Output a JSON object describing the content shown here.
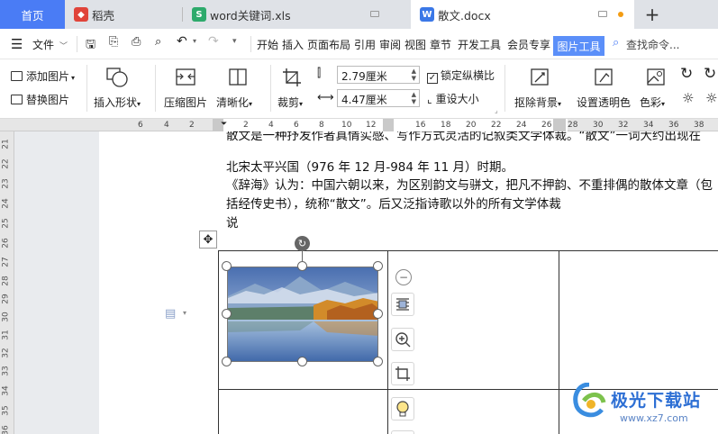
{
  "tabs": {
    "home": "首页",
    "daoke": "稻壳",
    "xls": "word关键词.xls",
    "doc": "散文.docx",
    "add": "+"
  },
  "menu": {
    "file": "文件",
    "items": [
      "开始",
      "插入",
      "页面布局",
      "引用",
      "审阅",
      "视图",
      "章节",
      "开发工具",
      "会员专享"
    ],
    "active": "图片工具",
    "search": "查找命令..."
  },
  "ribbon": {
    "add_picture": "添加图片",
    "replace_picture": "替换图片",
    "insert_shape": "插入形状",
    "compress": "压缩图片",
    "sharpen": "清晰化",
    "crop": "裁剪",
    "height": "2.79厘米",
    "width": "4.47厘米",
    "lock_ratio": "锁定纵横比",
    "reset_size": "重设大小",
    "remove_bg": "抠除背景",
    "set_transparent": "设置透明色",
    "color": "色彩"
  },
  "ruler": {
    "h": [
      "6",
      "4",
      "2",
      "2",
      "4",
      "6",
      "8",
      "10",
      "12",
      "16",
      "18",
      "20",
      "22",
      "24",
      "26",
      "28",
      "30",
      "32",
      "34",
      "36",
      "38"
    ],
    "v": [
      "21",
      "22",
      "23",
      "24",
      "25",
      "26",
      "27",
      "28",
      "29",
      "30",
      "31",
      "32",
      "33",
      "34",
      "35",
      "36"
    ]
  },
  "document": {
    "line1": "散文是一种抒发作者真情实感、写作方式灵活的记叙类文学体裁。“散文”一词大约出现在",
    "line2": "北宋太平兴国（976 年 12 月-984 年 11 月）时期。",
    "line3": "《辞海》认为：中国六朝以来，为区别韵文与骈文，把凡不押韵、不重排偶的散体文章（包",
    "line4": "括经传史书），统称“散文”。后又泛指诗歌以外的所有文学体裁",
    "line5": "说"
  },
  "watermark": {
    "title": "极光下载站",
    "url": "www.xz7.com"
  },
  "colors": {
    "accent": "#4a7cf5",
    "active_tab": "#5b8ff9",
    "sheet_green": "#2eaa6c",
    "daoke_red": "#e0443a",
    "doc_blue": "#3b78e7"
  }
}
